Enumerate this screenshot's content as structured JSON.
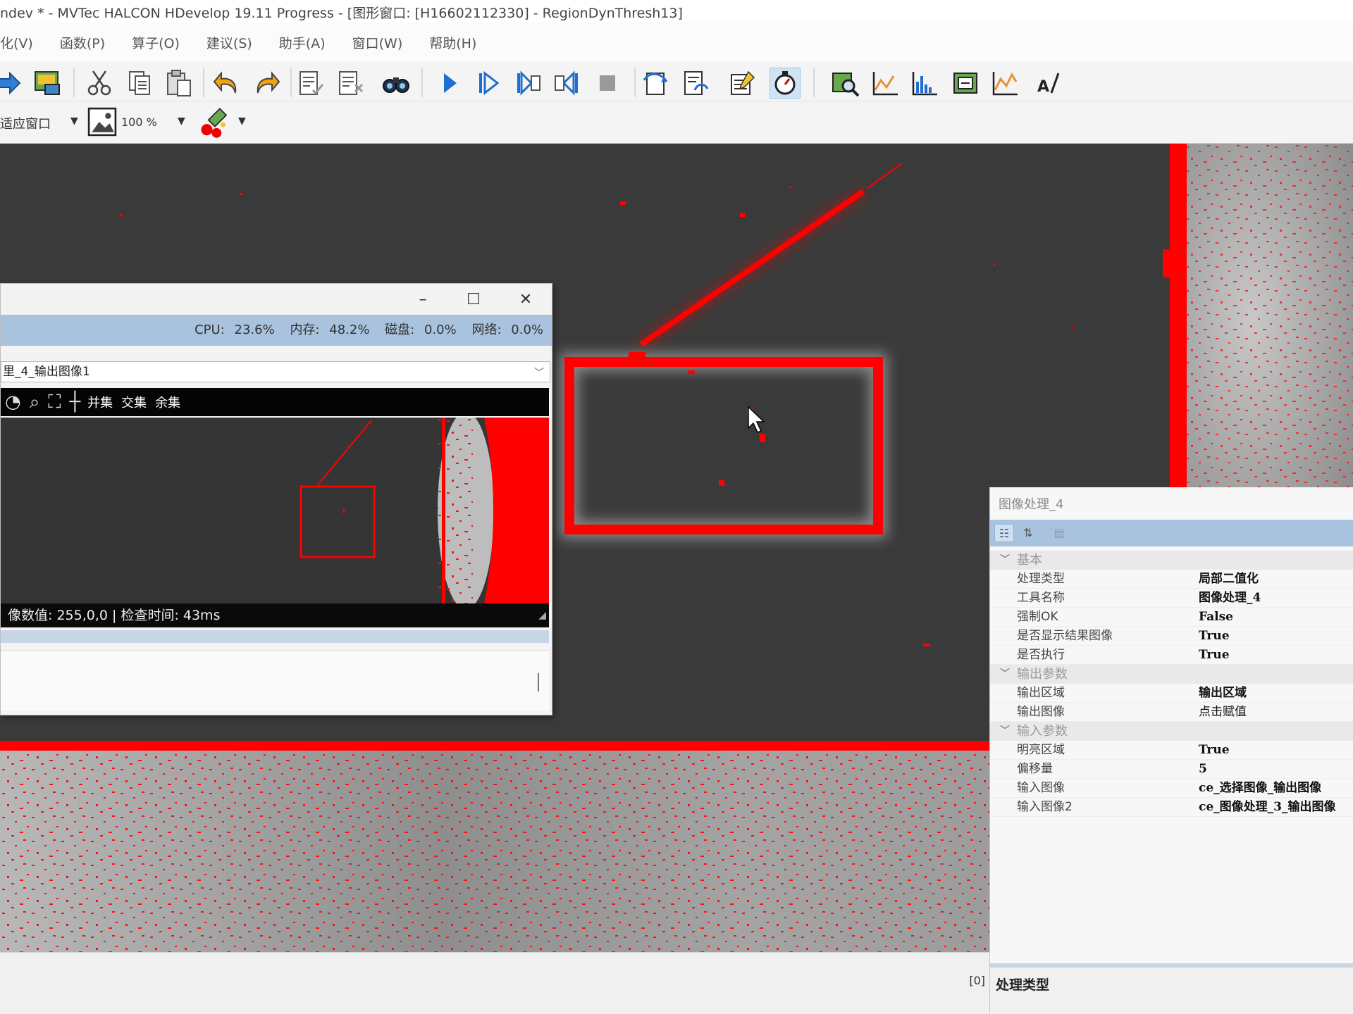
{
  "window": {
    "title": "ndev * - MVTec HALCON HDevelop 19.11 Progress - [图形窗口: [H16602112330] - RegionDynThresh13]"
  },
  "menu": [
    "化(V)",
    "函数(P)",
    "算子(O)",
    "建议(S)",
    "助手(A)",
    "窗口(W)",
    "帮助(H)"
  ],
  "toolbar2": {
    "fit_label": "适应窗口",
    "zoom_value": "100 %"
  },
  "sub_window": {
    "status": {
      "cpu_label": "CPU:",
      "cpu_value": "23.6%",
      "mem_label": "内存:",
      "mem_value": "48.2%",
      "disk_label": "磁盘:",
      "disk_value": "0.0%",
      "net_label": "网络:",
      "net_value": "0.0%"
    },
    "combo_value": "里_4_输出图像1",
    "tools": {
      "union": "并集",
      "intersect": "交集",
      "remain": "余集"
    },
    "info": "像数值: 255,0,0  |  检查时间: 43ms"
  },
  "property_panel": {
    "title": "图像处理_4",
    "categories": [
      {
        "name": "基本",
        "rows": [
          {
            "name": "处理类型",
            "value": "局部二值化",
            "bold": true
          },
          {
            "name": "工具名称",
            "value": "图像处理_4",
            "bold": true
          },
          {
            "name": "强制OK",
            "value": "False",
            "bold": true
          },
          {
            "name": "是否显示结果图像",
            "value": "True",
            "bold": true
          },
          {
            "name": "是否执行",
            "value": "True",
            "bold": true
          }
        ]
      },
      {
        "name": "输出参数",
        "rows": [
          {
            "name": "输出区域",
            "value": "输出区域",
            "bold": true
          },
          {
            "name": "输出图像",
            "value": "点击赋值",
            "bold": false
          }
        ]
      },
      {
        "name": "输入参数",
        "rows": [
          {
            "name": "明亮区域",
            "value": "True",
            "bold": true
          },
          {
            "name": "偏移量",
            "value": "5",
            "bold": true
          },
          {
            "name": "输入图像",
            "value": "ce_选择图像_输出图像",
            "bold": true
          },
          {
            "name": "输入图像2",
            "value": "ce_图像处理_3_输出图像",
            "bold": true
          }
        ]
      }
    ],
    "description_title": "处理类型"
  },
  "bottom": {
    "index_label": "[0]"
  },
  "colors": {
    "region_red": "#ff0000",
    "panel_blue": "#a9c2dd",
    "canvas_dark": "#3b3b3b"
  }
}
